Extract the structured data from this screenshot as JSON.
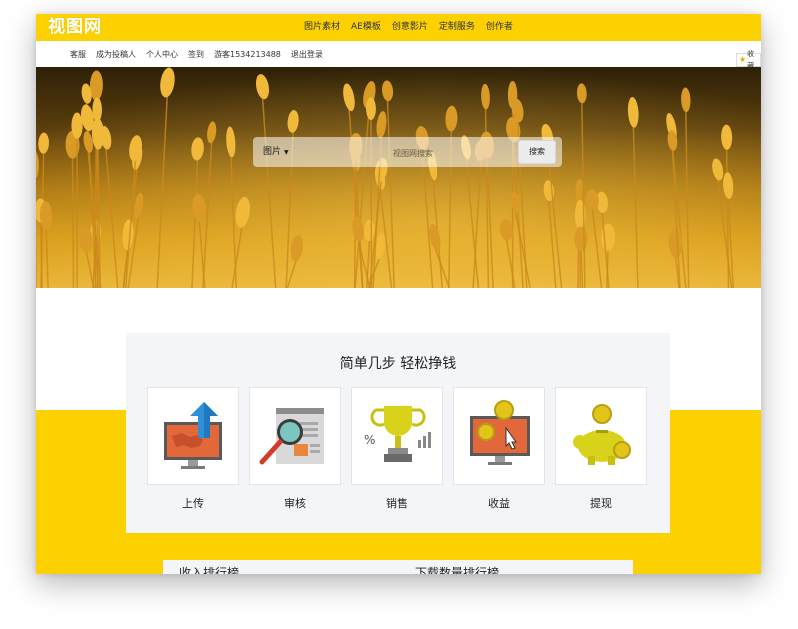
{
  "site": {
    "logo": "视图网"
  },
  "main_nav": [
    "图片素材",
    "AE模板",
    "创意影片",
    "定制服务",
    "创作者"
  ],
  "sub_nav": [
    "客服",
    "成为投稿人",
    "个人中心",
    "签到",
    "游客1534213488",
    "退出登录"
  ],
  "favorite": {
    "label": "收藏"
  },
  "search": {
    "type_label": "图片",
    "placeholder": "视图网搜索",
    "button_label": "搜索"
  },
  "steps": {
    "title": "简单几步 轻松挣钱",
    "items": [
      {
        "label": "上传",
        "icon": "upload-monitor-icon"
      },
      {
        "label": "审核",
        "icon": "review-magnifier-icon"
      },
      {
        "label": "销售",
        "icon": "sales-trophy-icon"
      },
      {
        "label": "收益",
        "icon": "earnings-monitor-icon"
      },
      {
        "label": "提现",
        "icon": "piggy-bank-icon"
      }
    ]
  },
  "rankings": {
    "income_title": "收入排行榜",
    "download_title": "下载数量排行榜"
  },
  "colors": {
    "brand_yellow": "#fdd100",
    "panel_gray": "#f4f5f8"
  }
}
